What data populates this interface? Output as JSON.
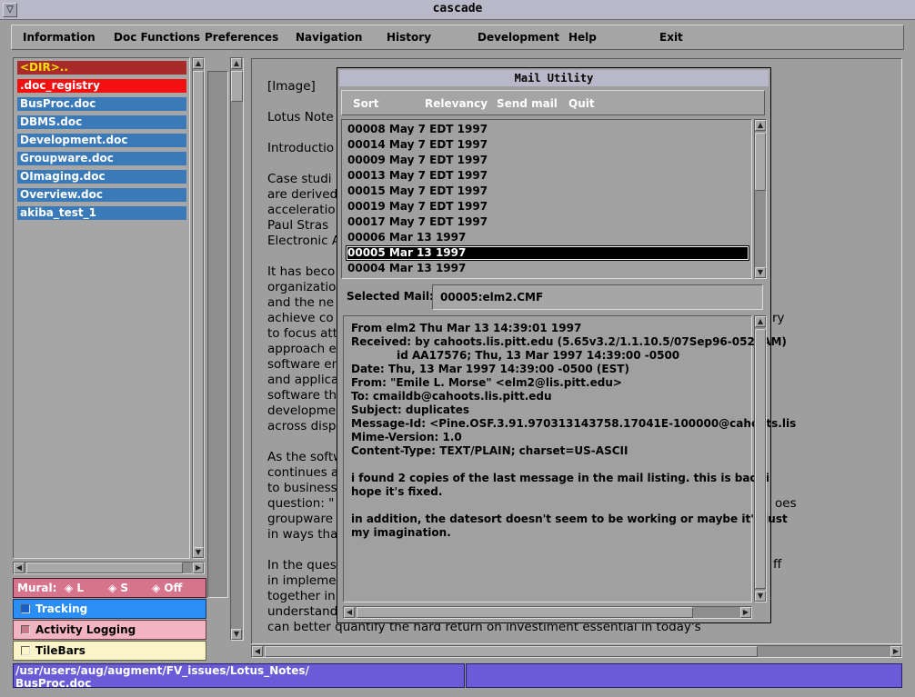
{
  "window": {
    "title": "cascade",
    "title_button": "▽"
  },
  "menubar": {
    "items": [
      "Information",
      "Doc Functions",
      "Preferences",
      "Navigation",
      "History",
      "Development",
      "Help",
      "Exit"
    ]
  },
  "files": {
    "items": [
      {
        "label": "<DIR>..",
        "color": "#a82a2a",
        "text_color": "#ffe000"
      },
      {
        "label": ".doc_registry",
        "color": "#f21010",
        "text_color": "#ffffff"
      },
      {
        "label": "BusProc.doc",
        "color": "#3a7ab8",
        "text_color": "#ffffff"
      },
      {
        "label": "DBMS.doc",
        "color": "#3a7ab8",
        "text_color": "#ffffff"
      },
      {
        "label": "Development.doc",
        "color": "#3a7ab8",
        "text_color": "#ffffff"
      },
      {
        "label": "Groupware.doc",
        "color": "#3a7ab8",
        "text_color": "#ffffff"
      },
      {
        "label": "OImaging.doc",
        "color": "#3a7ab8",
        "text_color": "#ffffff"
      },
      {
        "label": "Overview.doc",
        "color": "#3a7ab8",
        "text_color": "#ffffff"
      },
      {
        "label": "akiba_test_1",
        "color": "#3a7ab8",
        "text_color": "#ffffff"
      }
    ]
  },
  "mural": {
    "label": "Mural:",
    "options": [
      "L",
      "S",
      "Off"
    ]
  },
  "options": {
    "tracking": "Tracking",
    "activity": "Activity Logging",
    "tilebars": "TileBars"
  },
  "document": {
    "lines": [
      "[Image]",
      "Lotus Note",
      "Introductio",
      "Case studi",
      "are derived",
      "acceleratio",
      " Paul Stras",
      "Electronic A",
      "It has beco",
      "organizatio",
      "and the ne",
      "achieve co",
      "to focus att",
      "approach e",
      "software en",
      "and applica",
      "software th",
      "developme",
      "across disp",
      "As the softw",
      "continues a",
      "to business",
      "question: \"",
      "groupware",
      "in ways tha",
      "In the ques",
      "in impleme",
      "together in",
      "understand",
      "can better quantify the hard return on investiment essential in today's"
    ],
    "right_fragments": [
      "ry",
      "oes",
      "ff"
    ]
  },
  "status": {
    "path_line1": "/usr/users/aug/augment/FV_issues/Lotus_Notes/",
    "path_line2": "BusProc.doc"
  },
  "mail": {
    "title": "Mail Utility",
    "menu": [
      "Sort",
      "Relevancy",
      "Send mail",
      "Quit"
    ],
    "messages": [
      "00008 May 7 EDT 1997",
      "00014 May 7 EDT 1997",
      "00009 May 7 EDT 1997",
      "00013 May 7 EDT 1997",
      "00015 May 7 EDT 1997",
      "00019 May 7 EDT 1997",
      "00017 May 7 EDT 1997",
      "00006 Mar 13 1997",
      "00005 Mar 13 1997",
      "00004 Mar 13 1997"
    ],
    "selected_index": 8,
    "selected_label": "Selected Mail:",
    "selected_value": "00005:elm2.CMF",
    "body_lines": [
      "From elm2 Thu Mar 13 14:39:01 1997",
      "Received: by cahoots.lis.pitt.edu (5.65v3.2/1.1.10.5/07Sep96-0521AM)",
      "            id AA17576; Thu, 13 Mar 1997 14:39:00 -0500",
      "Date: Thu, 13 Mar 1997 14:39:00 -0500 (EST)",
      "From: \"Emile L. Morse\" <elm2@lis.pitt.edu>",
      "To: cmaildb@cahoots.lis.pitt.edu",
      "Subject: duplicates",
      "Message-Id: <Pine.OSF.3.91.970313143758.17041E-100000@cahoots.lis",
      "Mime-Version: 1.0",
      "Content-Type: TEXT/PLAIN; charset=US-ASCII",
      "",
      "i found 2 copies of the last message in the mail listing. this is bad. i",
      "hope it's fixed.",
      "",
      "in addition, the datesort doesn't seem to be working or maybe it's just",
      "my imagination."
    ]
  }
}
